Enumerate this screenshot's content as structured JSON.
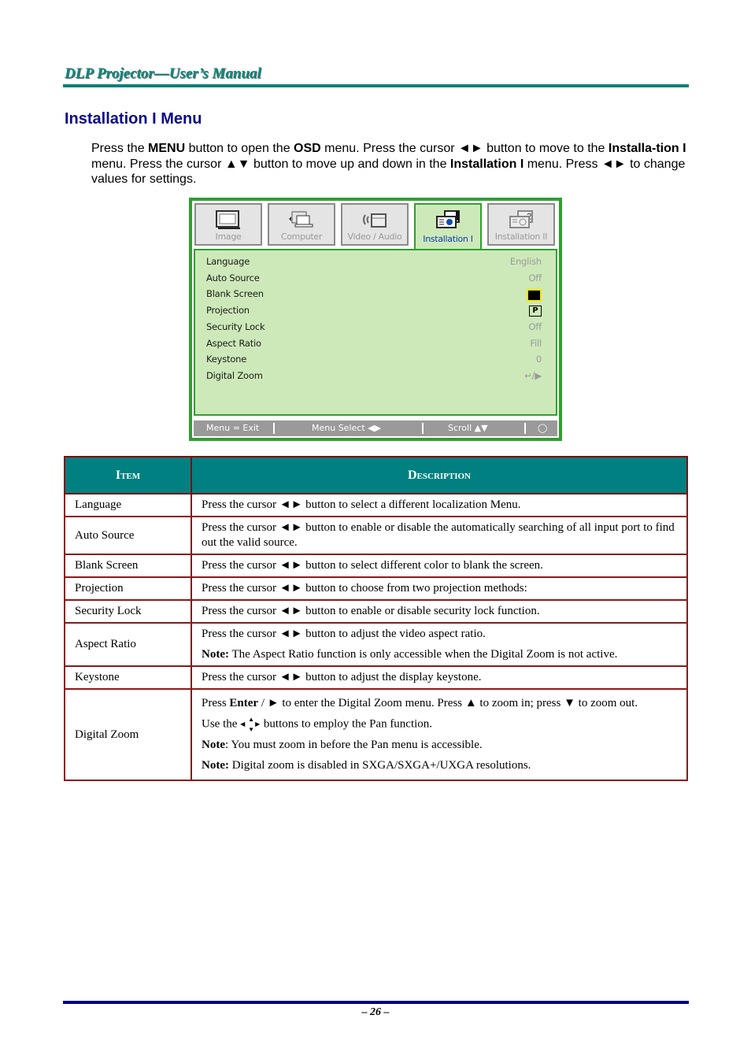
{
  "header": {
    "title": "DLP Projector—User’s Manual"
  },
  "section": {
    "title": "Installation I Menu",
    "intro": [
      {
        "t": "Press the ",
        "b": false
      },
      {
        "t": "MENU",
        "b": true
      },
      {
        "t": " button to open the ",
        "b": false
      },
      {
        "t": "OSD",
        "b": true
      },
      {
        "t": " menu. Press the cursor ◄► button to move to the ",
        "b": false
      },
      {
        "t": "Installa-tion I",
        "b": true
      },
      {
        "t": " menu. Press the cursor ▲▼ button to move up and down in the ",
        "b": false
      },
      {
        "t": "Installation I",
        "b": true
      },
      {
        "t": " menu. Press ◄► to change values for settings.",
        "b": false
      }
    ]
  },
  "osd": {
    "colors": {
      "frame": "#2fa02f",
      "panel": "#cde9b9",
      "active_label": "#0b3da8"
    },
    "tabs": [
      {
        "label": "Image",
        "icon": "image-icon",
        "active": false
      },
      {
        "label": "Computer",
        "icon": "computer-icon",
        "active": false
      },
      {
        "label": "Video / Audio",
        "icon": "video-audio-icon",
        "active": false
      },
      {
        "label": "Installation I",
        "icon": "installation-1-icon",
        "active": true
      },
      {
        "label": "Installation II",
        "icon": "installation-2-icon",
        "active": false
      }
    ],
    "items": [
      {
        "label": "Language",
        "value": "English"
      },
      {
        "label": "Auto Source",
        "value": "Off"
      },
      {
        "label": "Blank Screen",
        "value": "black-swatch"
      },
      {
        "label": "Projection",
        "value": "P"
      },
      {
        "label": "Security Lock",
        "value": "Off"
      },
      {
        "label": "Aspect Ratio",
        "value": "Fill"
      },
      {
        "label": "Keystone",
        "value": "0"
      },
      {
        "label": "Digital Zoom",
        "value": "↵/▶"
      }
    ],
    "footer": {
      "exit": "Menu = Exit",
      "select": "Menu Select ◀▶",
      "scroll": "Scroll ▲▼",
      "icon": "lamp-icon"
    }
  },
  "table": {
    "headers": [
      "Item",
      "Description"
    ],
    "rows": [
      {
        "item": "Language",
        "desc": [
          "Press the cursor ◄► button to select a different localization Menu."
        ]
      },
      {
        "item": "Auto Source",
        "desc": [
          "Press the cursor ◄► button to enable or disable the automatically searching of all input port to find out the valid source."
        ]
      },
      {
        "item": "Blank Screen",
        "desc": [
          "Press the cursor ◄► button to select different color to blank the screen."
        ]
      },
      {
        "item": "Projection",
        "desc": [
          "Press the cursor ◄► button to choose from two projection methods:"
        ]
      },
      {
        "item": "Security Lock",
        "desc": [
          "Press the cursor ◄► button to enable or disable security lock function."
        ]
      },
      {
        "item": "Aspect Ratio",
        "desc": [
          "Press the cursor ◄► button to adjust the video aspect ratio."
        ],
        "note": {
          "b": "Note:",
          "t": " The Aspect Ratio function is only accessible when the Digital Zoom is not active."
        }
      },
      {
        "item": "Keystone",
        "desc": [
          "Press the cursor ◄► button to adjust the display keystone."
        ]
      },
      {
        "item": "Digital Zoom",
        "p1": {
          "a": "Press ",
          "b": "Enter",
          "c": " / ► to enter the Digital Zoom menu. Press ▲ to zoom in; press ▼ to zoom out."
        },
        "p2": {
          "a": "Use the ",
          "c": " buttons to employ the Pan function."
        },
        "note1": {
          "b": "Note",
          "t": ": You must zoom in before the Pan menu is accessible."
        },
        "note2": {
          "b": "Note:",
          "t": " Digital zoom is disabled in SXGA/SXGA+/UXGA resolutions."
        }
      }
    ]
  },
  "footer": {
    "page": "– 26 –"
  }
}
